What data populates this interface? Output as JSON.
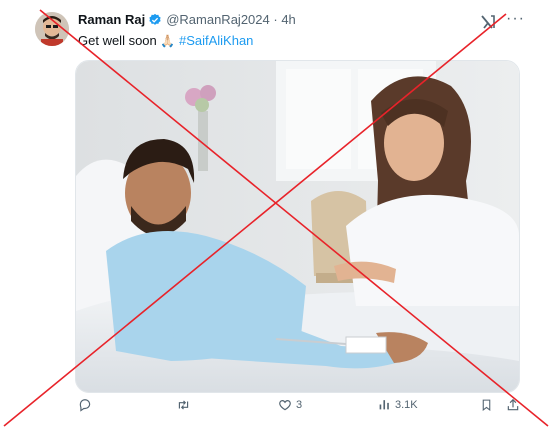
{
  "tweet": {
    "display_name": "Raman Raj",
    "handle": "@RamanRaj2024",
    "separator": "·",
    "time": "4h",
    "text_prefix": "Get well soon",
    "emoji": "🙏🏻",
    "hashtag": "#SaifAliKhan"
  },
  "actions": {
    "replies": "",
    "reposts": "",
    "likes": "3",
    "views": "3.1K"
  },
  "colors": {
    "link": "#1d9bf0",
    "verified": "#1d9bf0",
    "muted": "#536471",
    "cross": "#e8232a"
  }
}
